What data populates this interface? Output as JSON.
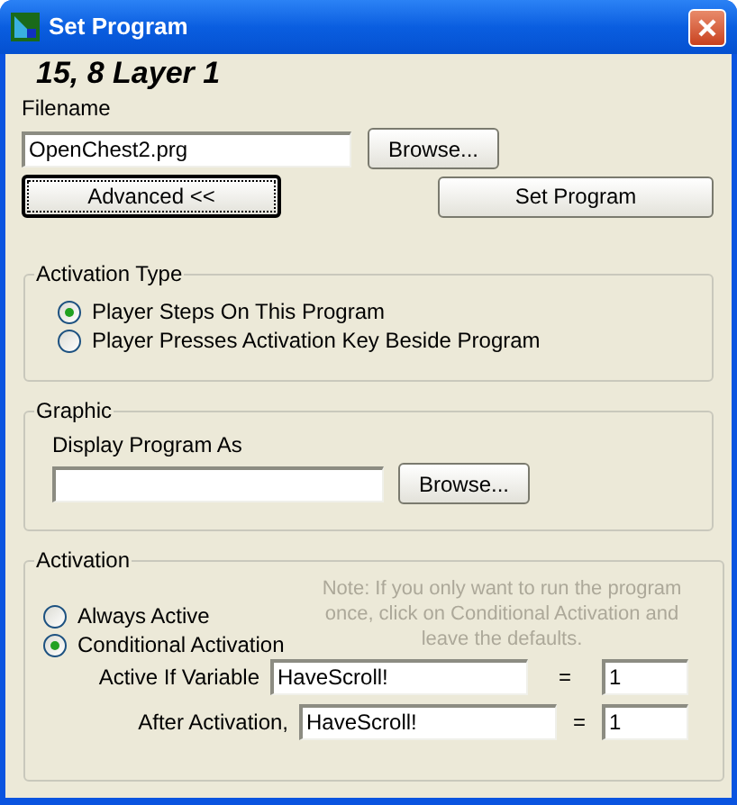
{
  "window": {
    "title": "Set Program"
  },
  "heading": "15, 8 Layer 1",
  "filename": {
    "label": "Filename",
    "value": "OpenChest2.prg",
    "browse": "Browse..."
  },
  "buttons": [
    {
      "label": "Advanced <<",
      "focused": true
    },
    {
      "label": "Set Program",
      "focused": false
    }
  ],
  "activation_type": {
    "title": "Activation Type",
    "options": [
      {
        "label": "Player Steps On This Program",
        "selected": true
      },
      {
        "label": "Player Presses Activation Key Beside Program",
        "selected": false
      }
    ]
  },
  "graphic": {
    "title": "Graphic",
    "field_label": "Display Program As",
    "browse": "Browse..."
  },
  "activation": {
    "title": "Activation",
    "options": [
      {
        "label": "Always Active",
        "selected": false
      },
      {
        "label": "Conditional Activation",
        "selected": true
      }
    ],
    "note": "Note:  If you only want to run the program once, click on Conditional Activation and leave the defaults.",
    "rows": [
      {
        "label": "Active If Variable",
        "variable": "HaveScroll!",
        "sign": "=",
        "value": "1"
      },
      {
        "label": "After Activation,",
        "variable": "HaveScroll!",
        "sign": "=",
        "value": "1"
      }
    ]
  }
}
